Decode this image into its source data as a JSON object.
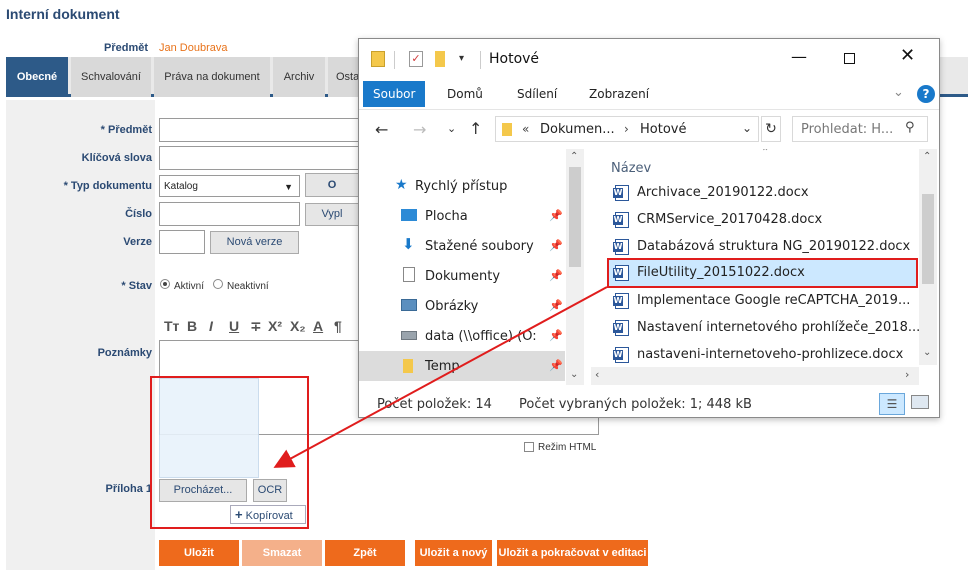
{
  "page": {
    "title": "Interní dokument",
    "subject_label": "Předmět",
    "subject_value": "Jan Doubrava"
  },
  "tabs": [
    {
      "label": "Obecné",
      "active": true
    },
    {
      "label": "Schvalování",
      "active": false
    },
    {
      "label": "Práva na dokument",
      "active": false
    },
    {
      "label": "Archiv",
      "active": false
    },
    {
      "label": "Osta",
      "active": false
    }
  ],
  "form": {
    "subject_label": "* Předmět",
    "keywords_label": "Klíčová slova",
    "doc_type_label": "* Typ dokumentu",
    "doc_type_value": "Katalog",
    "doc_type_btn": "O",
    "number_label": "Číslo",
    "fill_btn": "Vypl",
    "version_label": "Verze",
    "new_version_btn": "Nová verze",
    "state_label": "* Stav",
    "state_active": "Aktivní",
    "state_inactive": "Neaktivní",
    "notes_label": "Poznámky",
    "html_mode": "Režim HTML",
    "attachment_label": "Příloha 1",
    "browse_btn": "Procházet...",
    "ocr_btn": "OCR",
    "copy_btn": "Kopírovat"
  },
  "toolbar": [
    "Tт",
    "B",
    "I",
    "U",
    "∓",
    "X²",
    "X₂",
    "A",
    "¶"
  ],
  "buttons": {
    "save": "Uložit",
    "delete": "Smazat",
    "back": "Zpět",
    "save_new": "Uložit a nový",
    "save_continue": "Uložit a pokračovat v editaci"
  },
  "explorer": {
    "title": "Hotové",
    "ribbon_tabs": [
      "Soubor",
      "Domů",
      "Sdílení",
      "Zobrazení"
    ],
    "breadcrumb_prefix": "«",
    "breadcrumb_1": "Dokumen...",
    "breadcrumb_2": "Hotové",
    "search_placeholder": "Prohledat: H...",
    "column_name": "Název",
    "nav": [
      {
        "label": "Rychlý přístup",
        "icon": "star-icon"
      },
      {
        "label": "Plocha",
        "icon": "desktop-icon"
      },
      {
        "label": "Stažené soubory",
        "icon": "download-icon"
      },
      {
        "label": "Dokumenty",
        "icon": "documents-icon"
      },
      {
        "label": "Obrázky",
        "icon": "pictures-icon"
      },
      {
        "label": "data (\\\\office) (O:",
        "icon": "network-drive-icon"
      },
      {
        "label": "Temp",
        "icon": "folder-icon"
      }
    ],
    "files": [
      "Archivace_20190122.docx",
      "CRMService_20170428.docx",
      "Databázová struktura NG_20190122.docx",
      "FileUtility_20151022.docx",
      "Implementace Google reCAPTCHA_2019...",
      "Nastavení internetového prohlížeče_2018...",
      "nastaveni-internetoveho-prohlizece.docx"
    ],
    "selected_file_index": 3,
    "status_count": "Počet položek: 14",
    "status_selected": "Počet vybraných položek: 1; 448 kB"
  },
  "colors": {
    "accent_orange": "#ee6a1c",
    "accent_blue": "#2d5a88",
    "highlight_red": "#e01d1d",
    "explorer_blue": "#1979ca"
  }
}
